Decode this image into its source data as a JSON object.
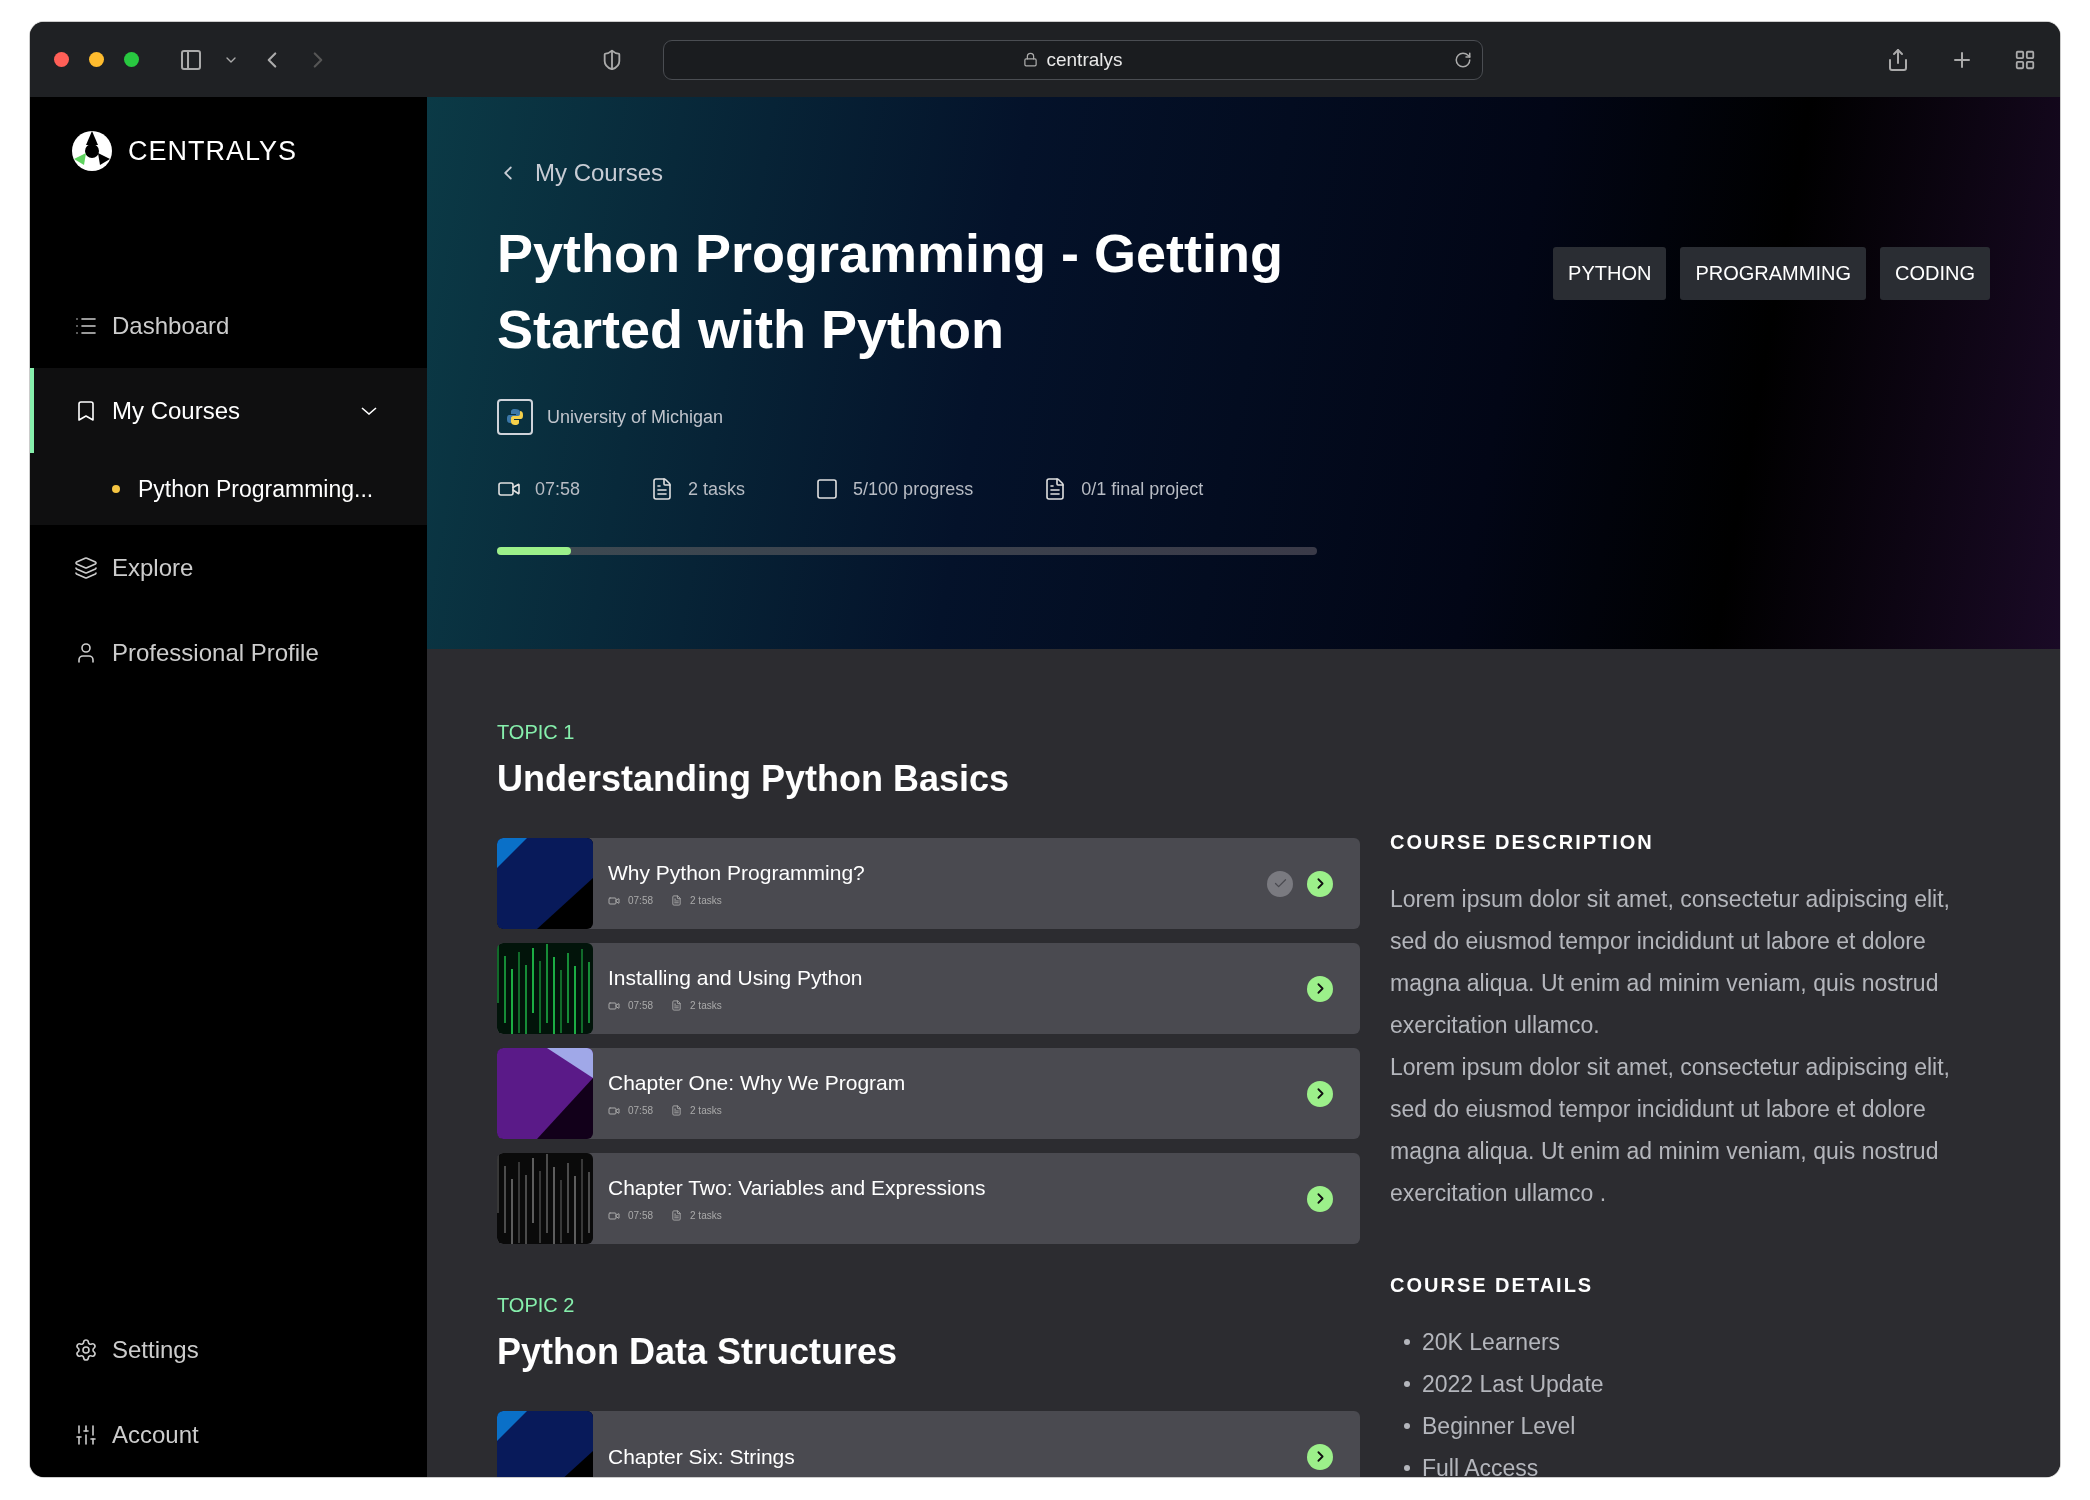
{
  "browser": {
    "address": "centralys"
  },
  "sidebar": {
    "logo": "CENTRALYS",
    "items": [
      {
        "label": "Dashboard",
        "selected": false
      },
      {
        "label": "My Courses",
        "selected": true,
        "expanded": true,
        "children": [
          {
            "label": "Python Programming...",
            "selected": true
          }
        ]
      },
      {
        "label": "Explore",
        "selected": false
      },
      {
        "label": "Professional Profile",
        "selected": false
      }
    ],
    "bottom_items": [
      {
        "label": "Settings"
      },
      {
        "label": "Account"
      }
    ]
  },
  "hero": {
    "back": "My Courses",
    "title": "Python Programming - Getting Started with Python",
    "provider": "University of Michigan",
    "tags": [
      "PYTHON",
      "PROGRAMMING",
      "CODING"
    ],
    "stats": [
      {
        "text": "07:58"
      },
      {
        "text": "2 tasks"
      },
      {
        "text": "5/100 progress"
      },
      {
        "text": "0/1 final project"
      }
    ],
    "progress": {
      "level": 0.09
    }
  },
  "topics": [
    {
      "label": "TOPIC 1",
      "title": "Understanding Python Basics",
      "lessons": [
        {
          "title": "Why Python Programming?",
          "duration": "07:58",
          "tasks": "2 tasks",
          "checked": true
        },
        {
          "title": "Installing and Using Python",
          "duration": "07:58",
          "tasks": "2 tasks",
          "checked": false
        },
        {
          "title": "Chapter One: Why We Program",
          "duration": "07:58",
          "tasks": "2 tasks",
          "checked": false
        },
        {
          "title": "Chapter Two: Variables and Expressions",
          "duration": "07:58",
          "tasks": "2 tasks",
          "checked": false
        }
      ]
    },
    {
      "label": "TOPIC 2",
      "title": "Python Data Structures",
      "lessons": [
        {
          "title": "Chapter Six: Strings",
          "checked": false
        }
      ]
    }
  ],
  "description": {
    "heading": "COURSE DESCRIPTION",
    "paragraphs": [
      "Lorem ipsum dolor sit amet, consectetur adipiscing elit, sed do eiusmod tempor incididunt ut labore et dolore magna aliqua. Ut enim ad minim veniam, quis nostrud exercitation ullamco.",
      "Lorem ipsum dolor sit amet, consectetur adipiscing elit, sed do eiusmod tempor incididunt ut labore et dolore magna aliqua. Ut enim ad minim veniam, quis nostrud exercitation ullamco ."
    ]
  },
  "details": {
    "heading": "COURSE DETAILS",
    "items": [
      "20K Learners",
      "2022 Last Update",
      "Beginner Level",
      "Full Access"
    ]
  }
}
